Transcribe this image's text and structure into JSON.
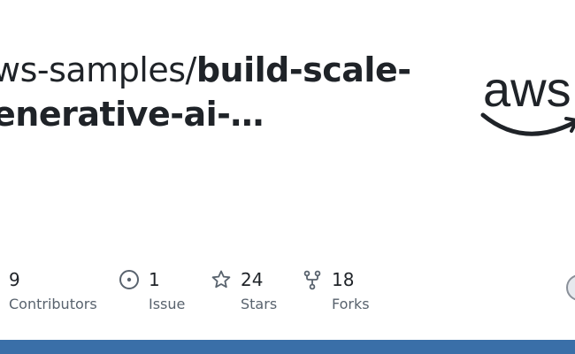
{
  "repo": {
    "owner": "ws-samples/",
    "name_line1": "build-scale-",
    "name_line2": "enerative-ai-…"
  },
  "logo": {
    "text": "aws",
    "icon": "aws-logo",
    "color": "#1f2328"
  },
  "stats": [
    {
      "value": "9",
      "label": "Contributors",
      "icon": ""
    },
    {
      "value": "1",
      "label": "Issue",
      "icon": "issue-opened-icon"
    },
    {
      "value": "24",
      "label": "Stars",
      "icon": "star-icon"
    },
    {
      "value": "18",
      "label": "Forks",
      "icon": "repo-forked-icon"
    }
  ],
  "colors": {
    "text": "#1f2328",
    "muted": "#59636e",
    "bottom_bar": "#3a6fa8"
  }
}
